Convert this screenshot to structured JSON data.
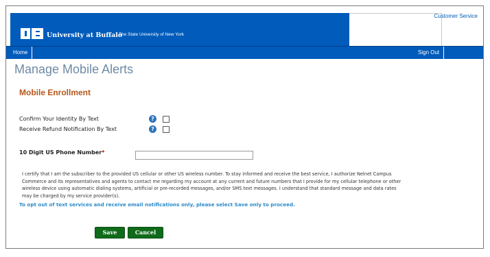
{
  "header": {
    "university_name": "University at Buffalo",
    "university_sub": "The State University of New York",
    "customer_service": "Customer Service",
    "brand_color": "#005bbb"
  },
  "nav": {
    "home": "Home",
    "sign_out": "Sign Out"
  },
  "page": {
    "title": "Manage Mobile Alerts",
    "section_title": "Mobile Enrollment"
  },
  "options": [
    {
      "label": "Confirm Your Identity By Text",
      "checked": false,
      "help_icon": "question-circle-icon"
    },
    {
      "label": "Receive Refund Notification By Text",
      "checked": false,
      "help_icon": "question-circle-icon"
    }
  ],
  "phone": {
    "label": "10 Digit US Phone Number",
    "required_marker": "*",
    "value": "",
    "placeholder": ""
  },
  "certify_text": "I certify that I am the subscriber to the provided US cellular or other US wireless number. To stay informed and receive the best service, I authorize Nelnet Campus Commerce and its representatives and agents to contact me regarding my account at any current and future numbers that I provide for my cellular telephone or other wireless device using automatic dialing systems, artificial or pre-recorded messages, and/or SMS text messages. I understand that standard message and data rates may be charged by my service provider(s).",
  "optout_text": "To opt out of text services and receive email notifications only, please select Save only to proceed.",
  "buttons": {
    "save": "Save",
    "cancel": "Cancel"
  }
}
